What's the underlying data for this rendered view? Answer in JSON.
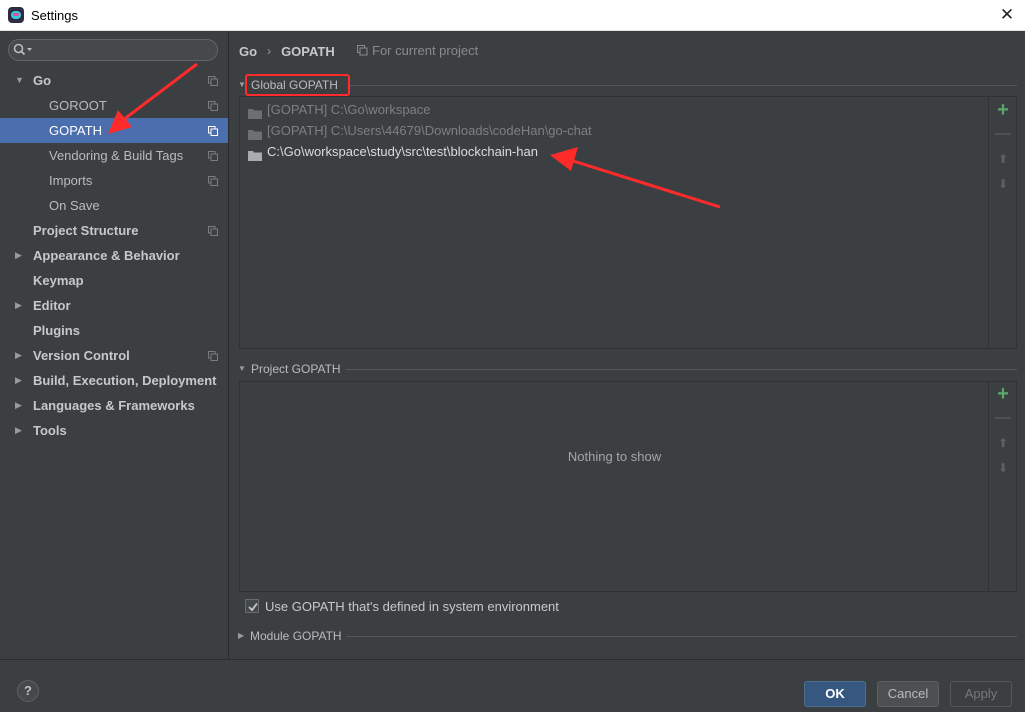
{
  "window": {
    "title": "Settings",
    "close_glyph": "✕"
  },
  "colors": {
    "accent_selected": "#4b6eaf",
    "annotation": "#ff2a2a",
    "add_green": "#59a869",
    "ok_button": "#365880"
  },
  "sidebar": {
    "search": {
      "placeholder": "",
      "value": ""
    },
    "items": [
      {
        "label": "Go",
        "bold": true,
        "expanded": true
      },
      {
        "label": "GOROOT"
      },
      {
        "label": "GOPATH",
        "selected": true
      },
      {
        "label": "Vendoring & Build Tags"
      },
      {
        "label": "Imports"
      },
      {
        "label": "On Save"
      },
      {
        "label": "Project Structure",
        "bold": true
      },
      {
        "label": "Appearance & Behavior",
        "bold": true,
        "expanded": false
      },
      {
        "label": "Keymap",
        "bold": true
      },
      {
        "label": "Editor",
        "bold": true,
        "expanded": false
      },
      {
        "label": "Plugins",
        "bold": true
      },
      {
        "label": "Version Control",
        "bold": true,
        "expanded": false
      },
      {
        "label": "Build, Execution, Deployment",
        "bold": true,
        "expanded": false
      },
      {
        "label": "Languages & Frameworks",
        "bold": true,
        "expanded": false
      },
      {
        "label": "Tools",
        "bold": true,
        "expanded": false
      }
    ]
  },
  "main": {
    "breadcrumb": {
      "parent": "Go",
      "separator": "›",
      "current": "GOPATH"
    },
    "scope_label": "For current project",
    "global": {
      "title": "Global GOPATH",
      "paths": [
        "[GOPATH] C:\\Go\\workspace",
        "[GOPATH] C:\\Users\\44679\\Downloads\\codeHan\\go-chat",
        "C:\\Go\\workspace\\study\\src\\test\\blockchain-han"
      ]
    },
    "project": {
      "title": "Project GOPATH",
      "empty_text": "Nothing to show"
    },
    "use_system_checkbox": {
      "label": "Use GOPATH that's defined in system environment",
      "checked": true
    },
    "module": {
      "title": "Module GOPATH"
    },
    "tools": {
      "add": "+",
      "remove": "—",
      "up": "⬆",
      "down": "⬇"
    }
  },
  "footer": {
    "help": "?",
    "ok": "OK",
    "cancel": "Cancel",
    "apply": "Apply"
  }
}
